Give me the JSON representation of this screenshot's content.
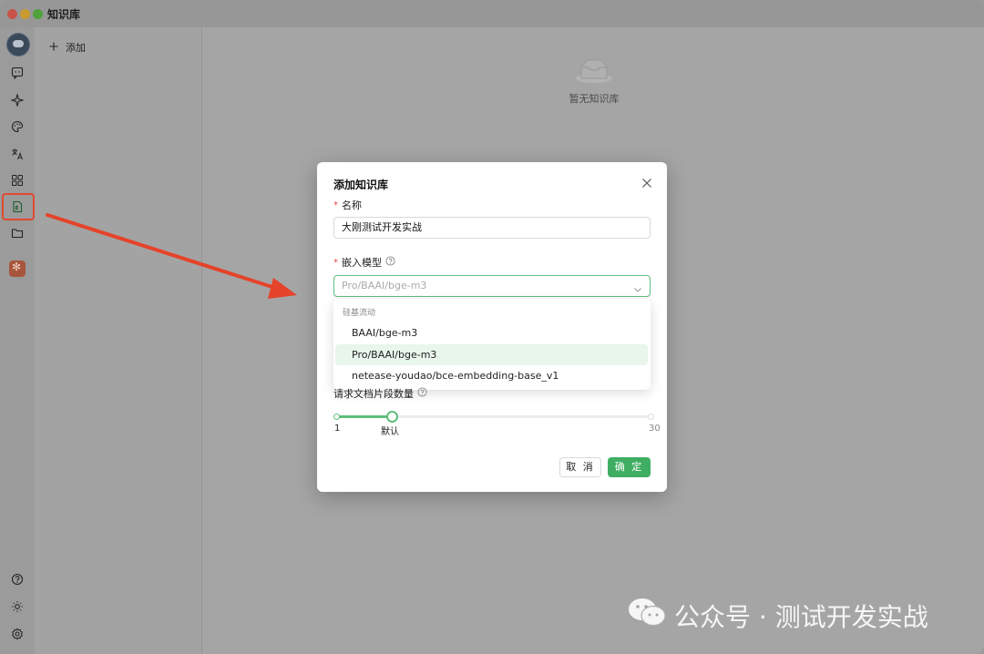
{
  "window": {
    "title": "知识库"
  },
  "sidebar_rail": {
    "icons": [
      "avatar",
      "chat-icon",
      "sparkle-icon",
      "palette-icon",
      "translate-icon",
      "apps-icon",
      "knowledge-icon",
      "folder-icon",
      "mini-app-icon",
      "help-icon",
      "theme-icon",
      "settings-icon"
    ],
    "active": "knowledge-icon"
  },
  "panel": {
    "add_label": "添加"
  },
  "main": {
    "empty_text": "暂无知识库"
  },
  "dialog": {
    "title": "添加知识库",
    "name_label": "名称",
    "name_value": "大刚测试开发实战",
    "model_label": "嵌入模型",
    "model_placeholder": "Pro/BAAI/bge-m3",
    "dropdown": {
      "group": "硅基流动",
      "options": [
        "BAAI/bge-m3",
        "Pro/BAAI/bge-m3",
        "netease-youdao/bce-embedding-base_v1"
      ],
      "selected_index": 1
    },
    "slider_label": "请求文档片段数量",
    "slider": {
      "min": "1",
      "max": "30",
      "default_label": "默认",
      "min_value": 1,
      "max_value": 30,
      "value": 6
    },
    "cancel_label": "取 消",
    "ok_label": "确 定"
  },
  "colors": {
    "accent": "#3fae63",
    "highlight_box": "#e04a2f",
    "arrow": "#e5432a"
  },
  "watermark": {
    "text": "公众号 · 测试开发实战"
  }
}
